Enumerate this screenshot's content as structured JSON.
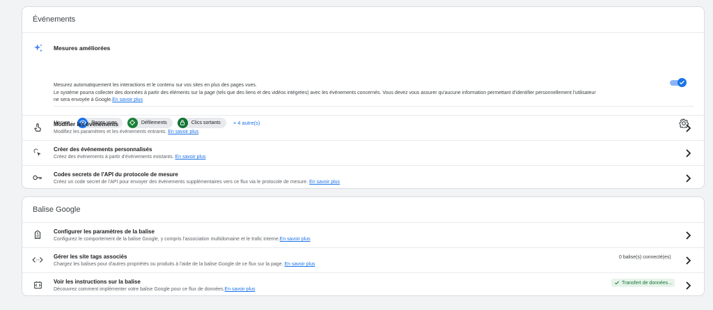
{
  "events": {
    "header": "Événements",
    "enhanced": {
      "title": "Mesures améliorées",
      "desc_line1": "Mesurez automatiquement les interactions et le contenu sur vos sites en plus des pages vues.",
      "desc_line2": "Le système pourra collecter des données à partir des éléments sur la page (tels que des liens et des vidéos intégrées) avec les événements concernés. Vous devez vous assurer qu'aucune information permettant d'identifier personnellement l'utilisateur",
      "desc_line3": "ne sera envoyée à Google.",
      "learn_more": "En savoir plus",
      "toggle_on": true,
      "measure_label": "Mesure :",
      "chips": [
        {
          "label": "Pages vues",
          "icon": "eye-icon",
          "color": "#1a73e8"
        },
        {
          "label": "Défilements",
          "icon": "crosshair-icon",
          "color": "#188038"
        },
        {
          "label": "Clics sortants",
          "icon": "lock-icon",
          "color": "#137333"
        }
      ],
      "more": "+ 4 autre(s)"
    },
    "rows": [
      {
        "title": "Modifier les événements",
        "desc": "Modifiez les paramètres et les événements entrants.",
        "link": "En savoir plus",
        "icon": "touch-icon"
      },
      {
        "title": "Créer des événements personnalisés",
        "desc": "Créez des événements à partir d'événements existants.",
        "link": "En savoir plus",
        "icon": "click-sparkle-icon"
      },
      {
        "title": "Codes secrets de l'API du protocole de mesure",
        "desc": "Créez un code secret de l'API pour envoyer des événements supplémentaires vers ce flux via le protocole de mesure.",
        "link": "En savoir plus",
        "icon": "key-icon"
      }
    ]
  },
  "tag": {
    "header": "Balise Google",
    "rows": [
      {
        "title": "Configurer les paramètres de la balise",
        "desc": "Configurez le comportement de la balise Google, y compris l'association multidomaine et le trafic interne.",
        "link": "En savoir plus",
        "icon": "tag-icon"
      },
      {
        "title": "Gérer les site tags associés",
        "desc": "Chargez les balises pour d'autres propriétés ou produits à l'aide de la balise Google de ce flux sur la page.",
        "link": "En savoir plus",
        "icon": "code-icon",
        "status": "0 balise(s) connecté(es)"
      },
      {
        "title": "Voir les instructions sur la balise",
        "desc": "Découvrez comment implémenter votre balise Google pour ce flux de données.",
        "link": "En savoir plus",
        "icon": "code-box-icon",
        "status": "Transfert de données..."
      }
    ]
  }
}
